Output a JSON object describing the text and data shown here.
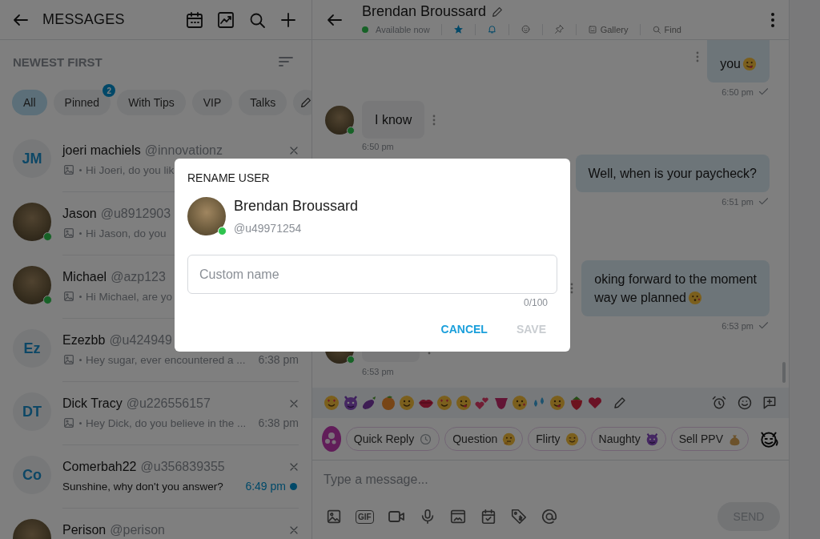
{
  "sidebar": {
    "title": "MESSAGES",
    "sort_label": "NEWEST FIRST",
    "filters": [
      {
        "label": "All",
        "selected": true
      },
      {
        "label": "Pinned",
        "selected": false,
        "badge": "2"
      },
      {
        "label": "With Tips",
        "selected": false
      },
      {
        "label": "VIP",
        "selected": false
      },
      {
        "label": "Talks",
        "selected": false
      }
    ],
    "conversations": [
      {
        "kind": "initials",
        "initials": "JM",
        "name": "joeri machiels",
        "handle": "@innovationz",
        "preview": "Hi Joeri, do you lik",
        "media": true,
        "online": false,
        "unread": false,
        "closable": true
      },
      {
        "kind": "photo",
        "name": "Jason",
        "handle": "@u8912903",
        "preview": "Hi Jason, do you",
        "media": true,
        "online": true,
        "unread": false,
        "closable": false
      },
      {
        "kind": "photo",
        "name": "Michael",
        "handle": "@azp123",
        "preview": "Hi Michael, are yo",
        "media": true,
        "online": true,
        "unread": false,
        "closable": false
      },
      {
        "kind": "initials",
        "initials": "Ez",
        "name": "Ezezbb",
        "handle": "@u424949",
        "preview": "Hey sugar, ever encountered a ...",
        "media": true,
        "time": "6:38 pm",
        "online": false,
        "unread": false,
        "closable": false
      },
      {
        "kind": "initials",
        "initials": "DT",
        "name": "Dick Tracy",
        "handle": "@u226556157",
        "preview": "Hey Dick, do you believe in the ...",
        "media": true,
        "time": "6:38 pm",
        "online": false,
        "unread": false,
        "closable": true
      },
      {
        "kind": "initials",
        "initials": "Co",
        "name": "Comerbah22",
        "handle": "@u356839355",
        "preview": "Sunshine, why don't you answer?",
        "media": false,
        "time": "6:49 pm",
        "online": false,
        "unread": true,
        "closable": true
      },
      {
        "kind": "photo",
        "name": "Perison",
        "handle": "@perison",
        "online": false,
        "unread": false,
        "closable": true
      }
    ]
  },
  "chat": {
    "title": "Brendan Broussard",
    "status": "Available now",
    "online": true,
    "toolbar": [
      {
        "kind": "star",
        "active": true
      },
      {
        "kind": "bell",
        "active": true
      },
      {
        "kind": "sticker",
        "active": false
      },
      {
        "kind": "pin",
        "active": false
      },
      {
        "kind": "gallery",
        "label": "Gallery",
        "active": false
      },
      {
        "kind": "find",
        "label": "Find",
        "active": false
      }
    ],
    "messages": [
      {
        "kind": "out",
        "lines": [
          "you"
        ],
        "time": "6:50 pm",
        "read": true
      },
      {
        "kind": "in",
        "lines": [
          "I know"
        ],
        "time": "6:50 pm",
        "online": true
      },
      {
        "kind": "out",
        "lines": [
          "Well, when is your paycheck?"
        ],
        "time": "6:51 pm",
        "read": true
      },
      {
        "kind": "out",
        "lines": [
          "oking forward to the moment",
          "way we planned"
        ],
        "time": "6:53 pm",
        "read": true
      },
      {
        "kind": "in",
        "time": "6:53 pm",
        "online": true
      }
    ],
    "quick_replies": [
      {
        "label": "Quick Reply"
      },
      {
        "label": "Question"
      },
      {
        "label": "Flirty"
      },
      {
        "label": "Naughty"
      },
      {
        "label": "Sell PPV"
      }
    ],
    "composer": {
      "placeholder": "Type a message...",
      "gif_label": "GIF",
      "send": "SEND",
      "send_disabled": true
    }
  },
  "dialog": {
    "title": "RENAME USER",
    "name": "Brendan Broussard",
    "handle": "@u49971254",
    "online": true,
    "field": {
      "placeholder": "Custom name",
      "counter": "0/100"
    },
    "buttons": [
      {
        "label": "CANCEL",
        "disabled": false
      },
      {
        "label": "SAVE",
        "disabled": true
      }
    ]
  }
}
